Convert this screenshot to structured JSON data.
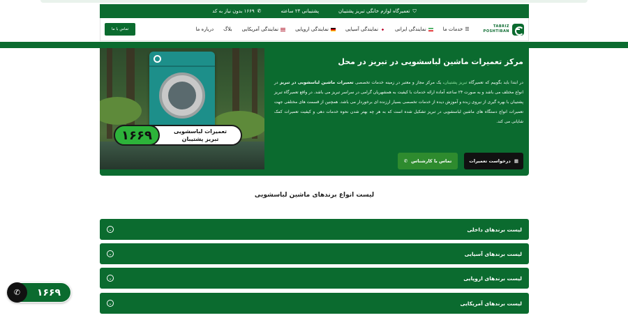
{
  "topbar": {
    "item1": "تعمیرگاه لوازم خانگی تبریز پشتیبان",
    "item2": "پشتیبانی ۲۴ ساعته",
    "item3": "۱۶۶۹ بدون نیاز به کد"
  },
  "nav": {
    "logo_line1": "TABRIZ",
    "logo_line2": "POSHTIBAN",
    "menu": [
      "خدمات ما",
      "نمایندگی ایرانی",
      "نمایندگی آسیایی",
      "نمایندگی اروپایی",
      "نمایندگی آمریکایی",
      "بلاگ",
      "درباره ما"
    ],
    "contact_button": "تماس با ما"
  },
  "hero": {
    "title": "مرکز تعمیرات ماشین لباسشویی در تبریز در محل",
    "p_intro": "در ابتدا باید بگوییم که تعمیرگاه ",
    "p_brand": "تبریز پشتیبان",
    "p_mid": "، یک مرکز مجاز و معتبر در زمینه خدمات تخصصی ",
    "p_bold": "تعمیرات ماشین لباسشویی در تبریز",
    "p_rest": " در انواع مختلف می باشد و به صورت ۲۴ ساعته آماده ارائه خدمات با کیفیت به همشهریان گرامی در سراسر تبریز می باشد. در واقع تعمیرگاه تبریز پشتیبان با بهره گیری از نیروی زبده و آموزش دیده از خدمات تخصصی بسیار ارزنده ای برخوردار می باشد. همچنین از قسمت های مختلفی جهت تعمیرات انواع دستگاه های ماشین لباسشویی در تبریز تشکیل شده است که به هر چه بهتر شدن نحوه خدمات دهی و کیفیت تعمیرات کمک شایانی می کند.",
    "btn_request": "درخواست تعمیرات",
    "btn_expert": "تماس با کارشناس",
    "banner_number": "۱۶۶۹",
    "banner_line1": "تعمیرات لباسشویی",
    "banner_line2": "تبریز پشتیبان"
  },
  "section_title": "لیست انواع برندهای ماشین لباسشویی",
  "accordion": [
    "لیست برندهای داخلی",
    "لیست برندهای آسیایی",
    "لیست برندهای اروپایی",
    "لیست برندهای آمریکایی"
  ],
  "floating_call": {
    "number": "۱۶۶۹"
  },
  "colors": {
    "primary": "#0b6b2f",
    "accent": "#2db33a",
    "dark": "#111111"
  }
}
